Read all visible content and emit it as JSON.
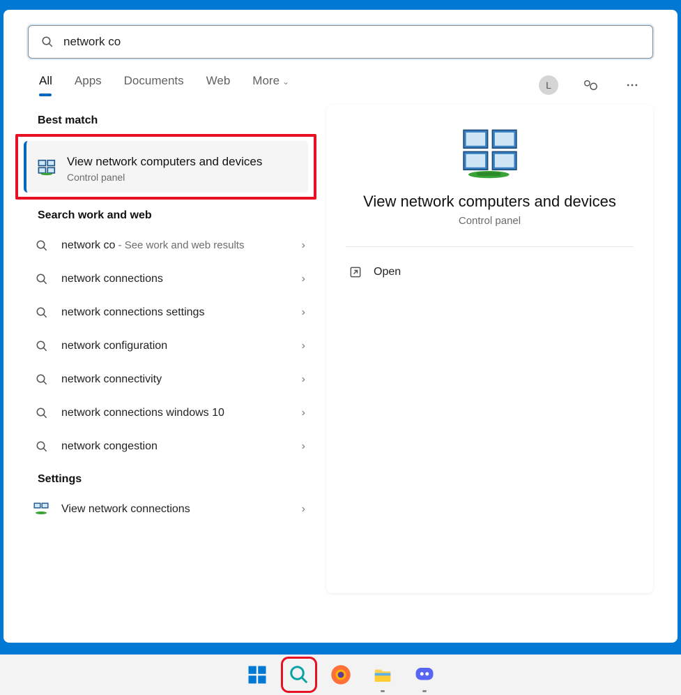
{
  "search": {
    "value": "network co"
  },
  "tabs": {
    "all": "All",
    "apps": "Apps",
    "documents": "Documents",
    "web": "Web",
    "more": "More"
  },
  "avatar_letter": "L",
  "sections": {
    "best_match": "Best match",
    "search_web": "Search work and web",
    "settings": "Settings"
  },
  "best_match": {
    "title": "View network computers and devices",
    "subtitle": "Control panel"
  },
  "web_results": [
    {
      "term": "network co",
      "suffix": " - See work and web results"
    },
    {
      "term": "network connections",
      "suffix": ""
    },
    {
      "term": "network connections settings",
      "suffix": ""
    },
    {
      "term": "network configuration",
      "suffix": ""
    },
    {
      "term": "network connectivity",
      "suffix": ""
    },
    {
      "term": "network connections windows 10",
      "suffix": ""
    },
    {
      "term": "network congestion",
      "suffix": ""
    }
  ],
  "settings_results": [
    {
      "label": "View network connections"
    }
  ],
  "preview": {
    "title": "View network computers and devices",
    "subtitle": "Control panel",
    "open": "Open"
  }
}
